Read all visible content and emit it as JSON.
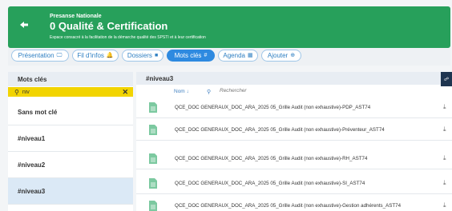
{
  "header": {
    "org": "Presanse Nationale",
    "title": "0 Qualité & Certification",
    "subtitle": "Espace consacré à la facilitation de la démarche qualité des SPSTI et à leur certification",
    "bg_color": "#27a05b"
  },
  "tabs": [
    {
      "label": "Présentation",
      "icon": "monitor-icon",
      "glyph": "🖵"
    },
    {
      "label": "Fil d'infos",
      "icon": "bell-icon",
      "glyph": "🔔"
    },
    {
      "label": "Dossiers",
      "icon": "folder-icon",
      "glyph": "■"
    },
    {
      "label": "Mots clés",
      "icon": "hash-icon",
      "glyph": "#",
      "active": true
    },
    {
      "label": "Agenda",
      "icon": "calendar-icon",
      "glyph": "▦"
    },
    {
      "label": "Ajouter",
      "icon": "plus-circle-icon",
      "glyph": "⊕"
    }
  ],
  "sidebar": {
    "header": "Mots clés",
    "search_value": "niv",
    "items": [
      {
        "label": "Sans mot clé"
      },
      {
        "label": "#niveau1"
      },
      {
        "label": "#niveau2"
      },
      {
        "label": "#niveau3",
        "active": true
      }
    ]
  },
  "main": {
    "header": "#niveau3",
    "sort_label": "Nom ↓",
    "search_placeholder": "Rechercher",
    "files": [
      {
        "name": "QCE_DOC GENERAUX_DOC_ARA_2025 05_Grille Audit (non exhaustive)-PDP_AST74"
      },
      {
        "name": "QCE_DOC GENERAUX_DOC_ARA_2025 05_Grille Audit (non exhaustive)-Préventeur_AST74"
      },
      {
        "name": "QCE_DOC GENERAUX_DOC_ARA_2025 05_Grille Audit (non exhaustive)-RH_AST74"
      },
      {
        "name": "QCE_DOC GENERAUX_DOC_ARA_2025 05_Grille Audit (non exhaustive)-SI_AST74"
      },
      {
        "name": "QCE_DOC GENERAUX_DOC_ARA_2025 05_Grille Audit (non exhaustive)-Gestion adhérents_AST74"
      }
    ]
  },
  "colors": {
    "accent": "#2e8ae0",
    "search_highlight": "#f2d400",
    "active_row": "#dbe9f6"
  }
}
